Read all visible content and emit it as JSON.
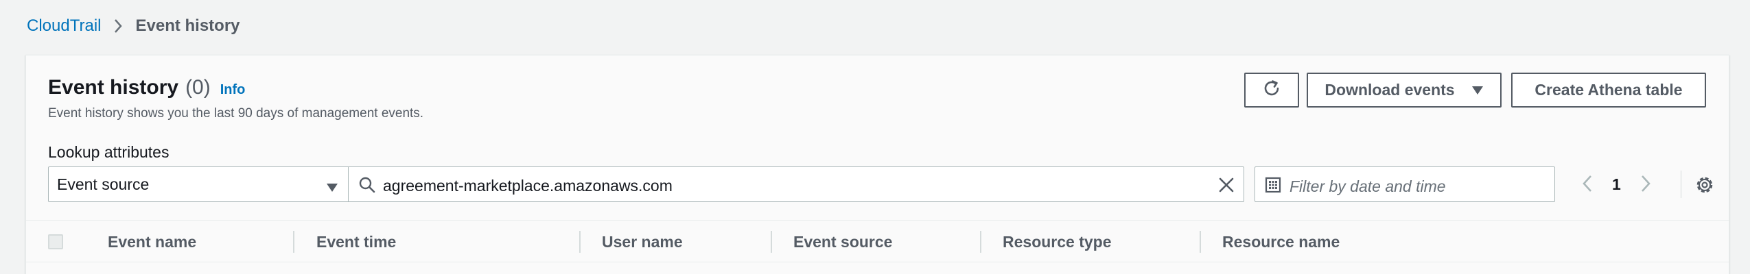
{
  "breadcrumb": {
    "link": "CloudTrail",
    "current": "Event history"
  },
  "header": {
    "title": "Event history",
    "count": "(0)",
    "info": "Info",
    "description": "Event history shows you the last 90 days of management events."
  },
  "actions": {
    "refresh_icon": "refresh-icon",
    "download_label": "Download events",
    "athena_label": "Create Athena table"
  },
  "lookup": {
    "label": "Lookup attributes",
    "attribute": "Event source",
    "search_value": "agreement-marketplace.amazonaws.com",
    "date_placeholder": "Filter by date and time"
  },
  "pagination": {
    "current_page": "1"
  },
  "table": {
    "columns": [
      "Event name",
      "Event time",
      "User name",
      "Event source",
      "Resource type",
      "Resource name"
    ]
  },
  "colors": {
    "link": "#0073bb",
    "text": "#16191f",
    "muted": "#545b64",
    "border": "#aab7b8",
    "page_bg": "#f2f3f3"
  }
}
